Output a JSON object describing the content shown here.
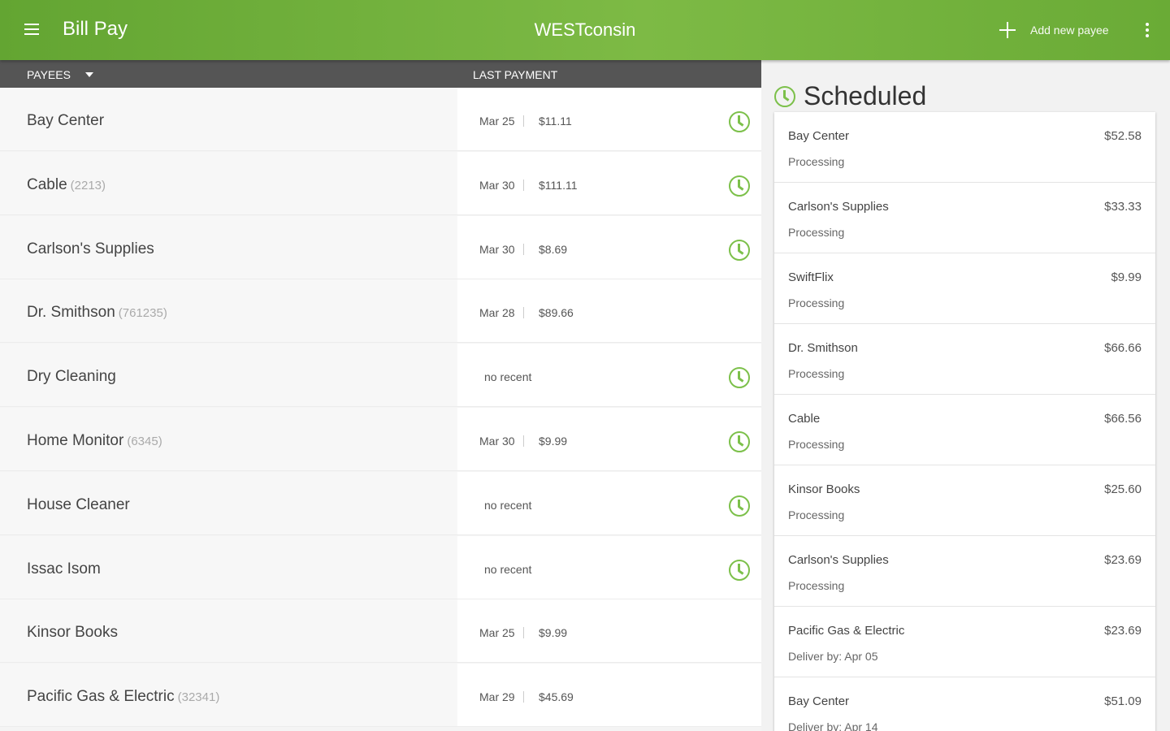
{
  "appbar": {
    "title": "Bill Pay",
    "brand": "WESTconsin",
    "add_payee_label": "Add new payee"
  },
  "columns": {
    "payees": "PAYEES",
    "last_payment": "LAST PAYMENT"
  },
  "payees": [
    {
      "name": "Bay Center",
      "account": "",
      "date": "Mar 25",
      "amount": "$11.11",
      "none": "",
      "scheduled": true
    },
    {
      "name": "Cable",
      "account": "(2213)",
      "date": "Mar 30",
      "amount": "$111.11",
      "none": "",
      "scheduled": true
    },
    {
      "name": "Carlson's Supplies",
      "account": "",
      "date": "Mar 30",
      "amount": "$8.69",
      "none": "",
      "scheduled": true
    },
    {
      "name": "Dr. Smithson",
      "account": "(761235)",
      "date": "Mar 28",
      "amount": "$89.66",
      "none": "",
      "scheduled": false
    },
    {
      "name": "Dry Cleaning",
      "account": "",
      "date": "",
      "amount": "",
      "none": "no recent",
      "scheduled": true
    },
    {
      "name": "Home Monitor",
      "account": "(6345)",
      "date": "Mar 30",
      "amount": "$9.99",
      "none": "",
      "scheduled": true
    },
    {
      "name": "House Cleaner",
      "account": "",
      "date": "",
      "amount": "",
      "none": "no recent",
      "scheduled": true
    },
    {
      "name": "Issac Isom",
      "account": "",
      "date": "",
      "amount": "",
      "none": "no recent",
      "scheduled": true
    },
    {
      "name": "Kinsor Books",
      "account": "",
      "date": "Mar 25",
      "amount": "$9.99",
      "none": "",
      "scheduled": false
    },
    {
      "name": "Pacific Gas & Electric",
      "account": "(32341)",
      "date": "Mar 29",
      "amount": "$45.69",
      "none": "",
      "scheduled": false
    }
  ],
  "scheduled": {
    "title": "Scheduled",
    "items": [
      {
        "name": "Bay Center",
        "amount": "$52.58",
        "status": "Processing"
      },
      {
        "name": "Carlson's Supplies",
        "amount": "$33.33",
        "status": "Processing"
      },
      {
        "name": "SwiftFlix",
        "amount": "$9.99",
        "status": "Processing"
      },
      {
        "name": "Dr. Smithson",
        "amount": "$66.66",
        "status": "Processing"
      },
      {
        "name": "Cable",
        "amount": "$66.56",
        "status": "Processing"
      },
      {
        "name": "Kinsor Books",
        "amount": "$25.60",
        "status": "Processing"
      },
      {
        "name": "Carlson's Supplies",
        "amount": "$23.69",
        "status": "Processing"
      },
      {
        "name": "Pacific Gas & Electric",
        "amount": "$23.69",
        "status": "Deliver by: Apr 05"
      },
      {
        "name": "Bay Center",
        "amount": "$51.09",
        "status": "Deliver by: Apr 14"
      }
    ]
  },
  "colors": {
    "accent": "#7dba45",
    "header_bar": "#555555",
    "clock": "#7cc04a"
  }
}
